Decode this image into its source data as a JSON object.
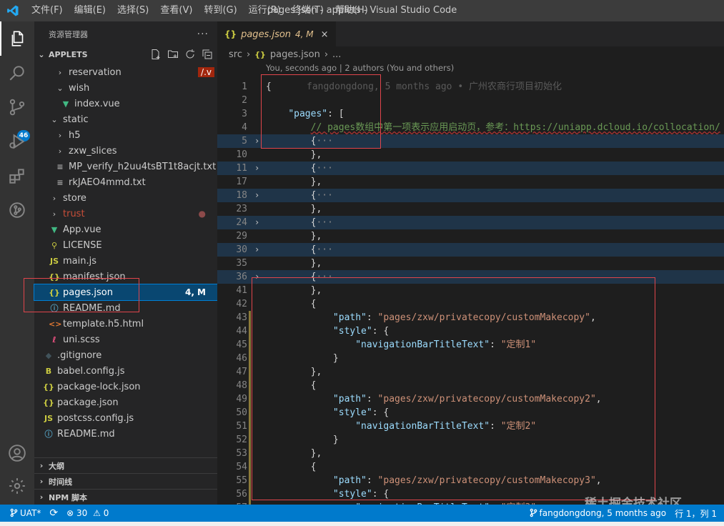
{
  "titlebar": {
    "menus": [
      "文件(F)",
      "编辑(E)",
      "选择(S)",
      "查看(V)",
      "转到(G)",
      "运行(R)",
      "终端(T)",
      "帮助(H)"
    ],
    "window_title": "pages.json - applets - Visual Studio Code"
  },
  "activity": {
    "scm_badge": "46"
  },
  "sidebar": {
    "header": "资源管理器",
    "more": "···",
    "project": "APPLETS",
    "tree": [
      {
        "label": "reservation",
        "icon": "folder",
        "twisty": "›",
        "badge": "/.v"
      },
      {
        "label": "wish",
        "icon": "folder",
        "twisty": "⌄"
      },
      {
        "label": "index.vue",
        "icon": "vue",
        "twisty": ""
      },
      {
        "label": "static",
        "icon": "folder",
        "twisty": "⌄"
      },
      {
        "label": "h5",
        "icon": "folder",
        "twisty": "›"
      },
      {
        "label": "zxw_slices",
        "icon": "folder",
        "twisty": "›"
      },
      {
        "label": "MP_verify_h2uu4tsBT1t8acjt.txt",
        "icon": "txt",
        "twisty": ""
      },
      {
        "label": "rkJAEO4mmd.txt",
        "icon": "txt",
        "twisty": ""
      },
      {
        "label": "store",
        "icon": "folder",
        "twisty": "›"
      },
      {
        "label": "trust",
        "icon": "folder",
        "twisty": "›",
        "status": "●"
      },
      {
        "label": "App.vue",
        "icon": "vue",
        "twisty": ""
      },
      {
        "label": "LICENSE",
        "icon": "license",
        "twisty": ""
      },
      {
        "label": "main.js",
        "icon": "js",
        "twisty": ""
      },
      {
        "label": "manifest.json",
        "icon": "json",
        "twisty": ""
      },
      {
        "label": "pages.json",
        "icon": "json",
        "twisty": "",
        "status": "4, M"
      },
      {
        "label": "README.md",
        "icon": "info",
        "twisty": ""
      },
      {
        "label": "template.h5.html",
        "icon": "html",
        "twisty": ""
      },
      {
        "label": "uni.scss",
        "icon": "scss",
        "twisty": ""
      },
      {
        "label": ".gitignore",
        "icon": "git",
        "twisty": ""
      },
      {
        "label": "babel.config.js",
        "icon": "babel",
        "twisty": ""
      },
      {
        "label": "package-lock.json",
        "icon": "json",
        "twisty": ""
      },
      {
        "label": "package.json",
        "icon": "json",
        "twisty": ""
      },
      {
        "label": "postcss.config.js",
        "icon": "js",
        "twisty": ""
      },
      {
        "label": "README.md",
        "icon": "info",
        "twisty": ""
      }
    ],
    "sections": [
      "大纲",
      "时间线",
      "NPM 脚本"
    ]
  },
  "tab": {
    "filename": "pages.json",
    "status": "4, M",
    "close": "×"
  },
  "breadcrumb": {
    "folder": "src",
    "file": "pages.json",
    "more": "..."
  },
  "codelens": "You, seconds ago | 2 authors (You and others)",
  "code": [
    {
      "n": "1",
      "t": "{",
      "blame": "fangdongdong, 5 months ago • 广州农商行项目初始化"
    },
    {
      "n": "2",
      "t": ""
    },
    {
      "n": "3",
      "t": "    \"pages\": ["
    },
    {
      "n": "4",
      "t": "        // pages数组中第一项表示应用启动页，参考：https://uniapp.dcloud.io/collocation/"
    },
    {
      "n": "5",
      "t": "        {···",
      "fold": true,
      "hl": true
    },
    {
      "n": "10",
      "t": "        },"
    },
    {
      "n": "11",
      "t": "        {···",
      "fold": true,
      "hl": true
    },
    {
      "n": "17",
      "t": "        },"
    },
    {
      "n": "18",
      "t": "        {···",
      "fold": true,
      "hl": true
    },
    {
      "n": "23",
      "t": "        },"
    },
    {
      "n": "24",
      "t": "        {···",
      "fold": true,
      "hl": true
    },
    {
      "n": "29",
      "t": "        },"
    },
    {
      "n": "30",
      "t": "        {···",
      "fold": true,
      "hl": true
    },
    {
      "n": "35",
      "t": "        },"
    },
    {
      "n": "36",
      "t": "        {···",
      "fold": true,
      "hl": true
    },
    {
      "n": "41",
      "t": "        },"
    },
    {
      "n": "42",
      "t": "        {"
    },
    {
      "n": "43",
      "t": "            \"path\": \"pages/zxw/privatecopy/customMakecopy\","
    },
    {
      "n": "44",
      "t": "            \"style\": {"
    },
    {
      "n": "45",
      "t": "                \"navigationBarTitleText\": \"定制1\""
    },
    {
      "n": "46",
      "t": "            }"
    },
    {
      "n": "47",
      "t": "        },"
    },
    {
      "n": "48",
      "t": "        {"
    },
    {
      "n": "49",
      "t": "            \"path\": \"pages/zxw/privatecopy/customMakecopy2\","
    },
    {
      "n": "50",
      "t": "            \"style\": {"
    },
    {
      "n": "51",
      "t": "                \"navigationBarTitleText\": \"定制2\""
    },
    {
      "n": "52",
      "t": "            }"
    },
    {
      "n": "53",
      "t": "        },"
    },
    {
      "n": "54",
      "t": "        {"
    },
    {
      "n": "55",
      "t": "            \"path\": \"pages/zxw/privatecopy/customMakecopy3\","
    },
    {
      "n": "56",
      "t": "            \"style\": {"
    },
    {
      "n": "57",
      "t": "                \"navigationBarTitleText\": \"定制3\""
    }
  ],
  "statusbar": {
    "branch": "UAT*",
    "sync": "⟳",
    "errors": "30",
    "warnings": "0",
    "blame": "fangdongdong, 5 months ago",
    "position": "行 1，列 1"
  },
  "watermark": "稀土掘金技术社区",
  "colors": {
    "accent": "#007acc",
    "selection": "#094771",
    "annotation": "#e0454b",
    "modified": "#e2c08d"
  }
}
